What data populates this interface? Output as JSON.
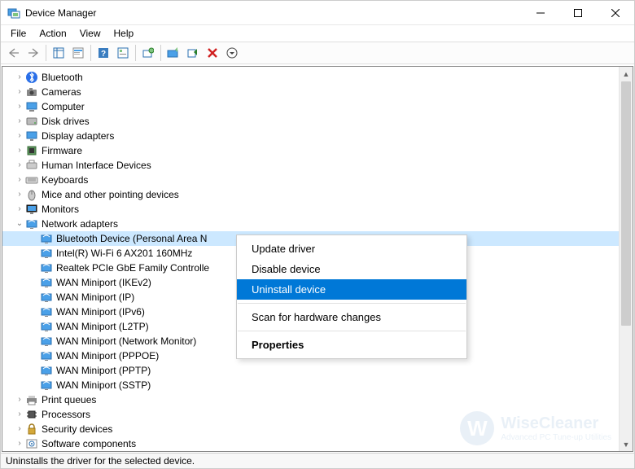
{
  "window": {
    "title": "Device Manager"
  },
  "menu": {
    "file": "File",
    "action": "Action",
    "view": "View",
    "help": "Help"
  },
  "tree": {
    "categories": [
      {
        "label": "Bluetooth",
        "icon": "bluetooth",
        "expanded": false
      },
      {
        "label": "Cameras",
        "icon": "camera",
        "expanded": false
      },
      {
        "label": "Computer",
        "icon": "computer",
        "expanded": false
      },
      {
        "label": "Disk drives",
        "icon": "disk",
        "expanded": false
      },
      {
        "label": "Display adapters",
        "icon": "display",
        "expanded": false
      },
      {
        "label": "Firmware",
        "icon": "firmware",
        "expanded": false
      },
      {
        "label": "Human Interface Devices",
        "icon": "hid",
        "expanded": false
      },
      {
        "label": "Keyboards",
        "icon": "keyboard",
        "expanded": false
      },
      {
        "label": "Mice and other pointing devices",
        "icon": "mouse",
        "expanded": false
      },
      {
        "label": "Monitors",
        "icon": "monitor",
        "expanded": false
      },
      {
        "label": "Network adapters",
        "icon": "network",
        "expanded": true
      }
    ],
    "network_children": [
      {
        "label": "Bluetooth Device (Personal Area N",
        "selected": true
      },
      {
        "label": "Intel(R) Wi-Fi 6 AX201 160MHz",
        "selected": false
      },
      {
        "label": "Realtek PCIe GbE Family Controlle",
        "selected": false
      },
      {
        "label": "WAN Miniport (IKEv2)",
        "selected": false
      },
      {
        "label": "WAN Miniport (IP)",
        "selected": false
      },
      {
        "label": "WAN Miniport (IPv6)",
        "selected": false
      },
      {
        "label": "WAN Miniport (L2TP)",
        "selected": false
      },
      {
        "label": "WAN Miniport (Network Monitor)",
        "selected": false
      },
      {
        "label": "WAN Miniport (PPPOE)",
        "selected": false
      },
      {
        "label": "WAN Miniport (PPTP)",
        "selected": false
      },
      {
        "label": "WAN Miniport (SSTP)",
        "selected": false
      }
    ],
    "trailing": [
      {
        "label": "Print queues",
        "icon": "printer"
      },
      {
        "label": "Processors",
        "icon": "cpu"
      },
      {
        "label": "Security devices",
        "icon": "security"
      },
      {
        "label": "Software components",
        "icon": "software"
      }
    ]
  },
  "context_menu": {
    "update": "Update driver",
    "disable": "Disable device",
    "uninstall": "Uninstall device",
    "scan": "Scan for hardware changes",
    "properties": "Properties"
  },
  "statusbar": {
    "text": "Uninstalls the driver for the selected device."
  },
  "watermark": {
    "brand": "WiseCleaner",
    "tagline": "Advanced PC Tune-up Utilities",
    "initial": "W"
  }
}
